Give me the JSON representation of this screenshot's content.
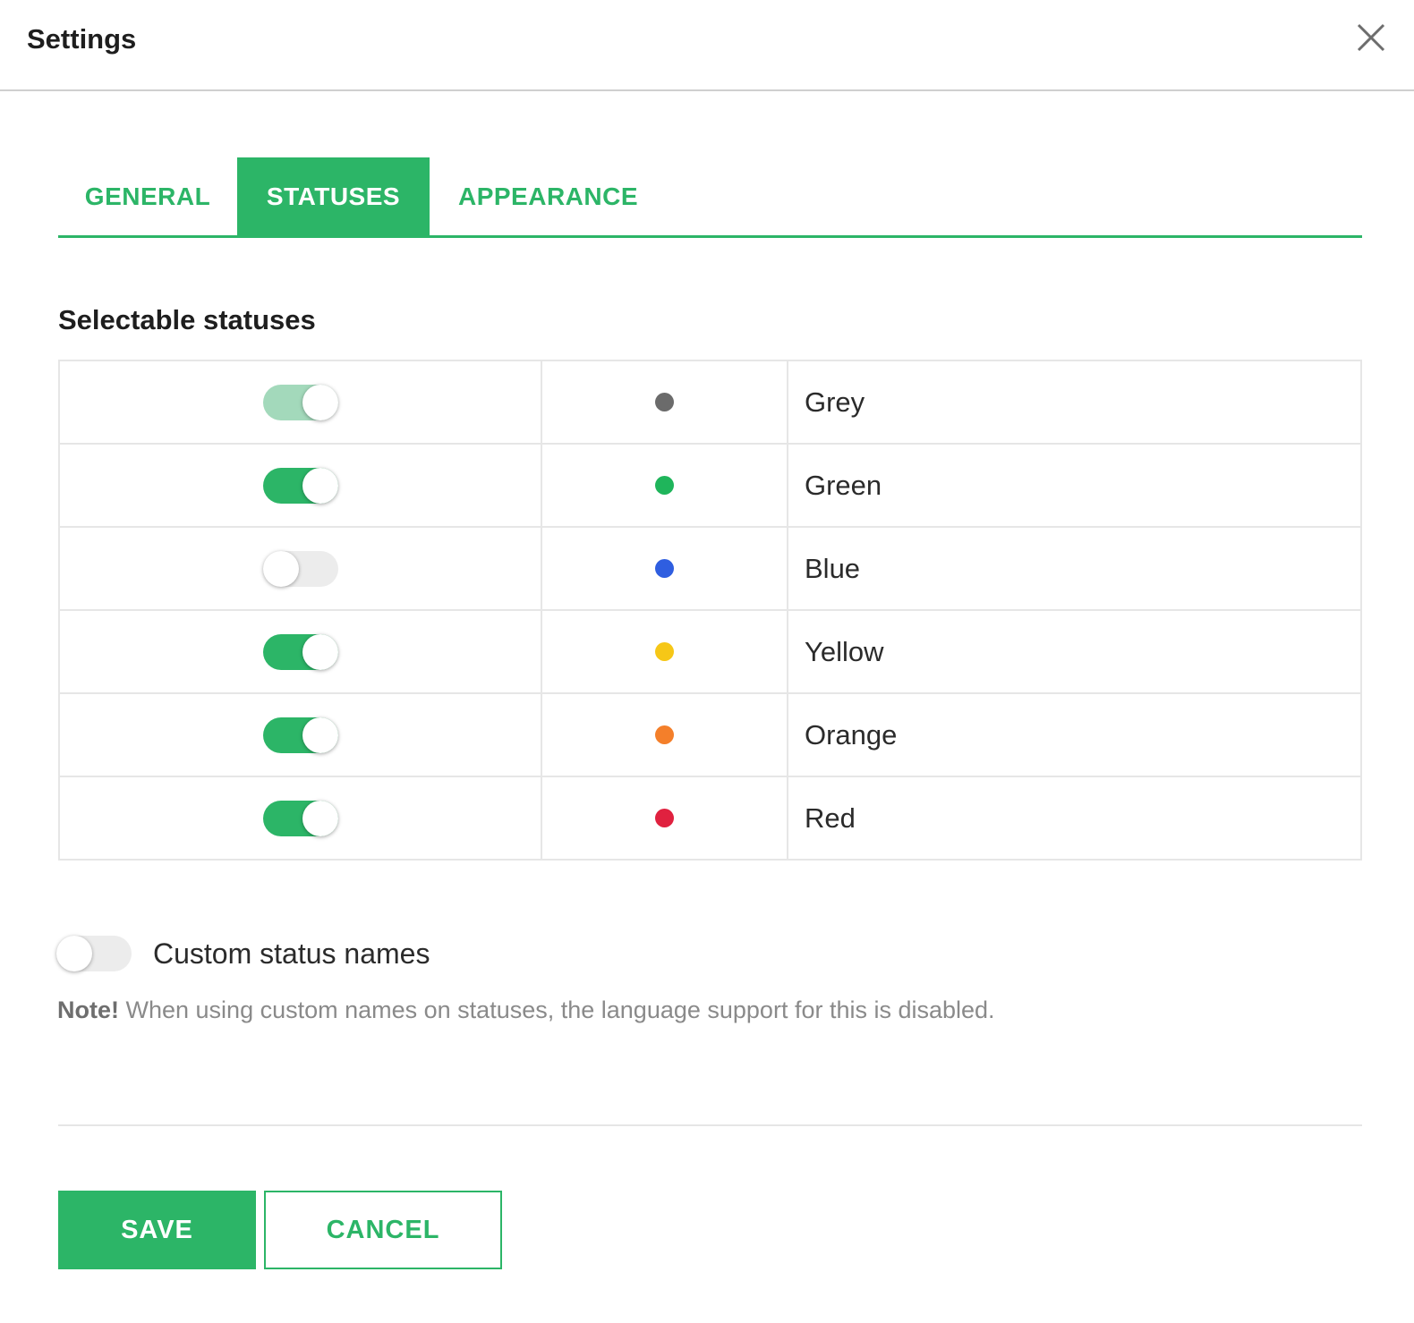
{
  "header": {
    "title": "Settings"
  },
  "tabs": [
    {
      "label": "GENERAL",
      "active": false
    },
    {
      "label": "STATUSES",
      "active": true
    },
    {
      "label": "APPEARANCE",
      "active": false
    }
  ],
  "section_title": "Selectable statuses",
  "statuses": [
    {
      "name": "Grey",
      "enabled": true,
      "locked": true,
      "color": "#6b6b6b"
    },
    {
      "name": "Green",
      "enabled": true,
      "locked": false,
      "color": "#1fb55b"
    },
    {
      "name": "Blue",
      "enabled": false,
      "locked": false,
      "color": "#2f5ee0"
    },
    {
      "name": "Yellow",
      "enabled": true,
      "locked": false,
      "color": "#f6c717"
    },
    {
      "name": "Orange",
      "enabled": true,
      "locked": false,
      "color": "#f47f2a"
    },
    {
      "name": "Red",
      "enabled": true,
      "locked": false,
      "color": "#e0213f"
    }
  ],
  "custom_names": {
    "label": "Custom status names",
    "enabled": false
  },
  "note": {
    "prefix": "Note!",
    "text": " When using custom names on statuses, the language support for this is disabled."
  },
  "buttons": {
    "save": "SAVE",
    "cancel": "CANCEL"
  },
  "colors": {
    "accent": "#2cb567",
    "accent_disabled": "#a3d9bb",
    "toggle_off": "#ececec"
  }
}
